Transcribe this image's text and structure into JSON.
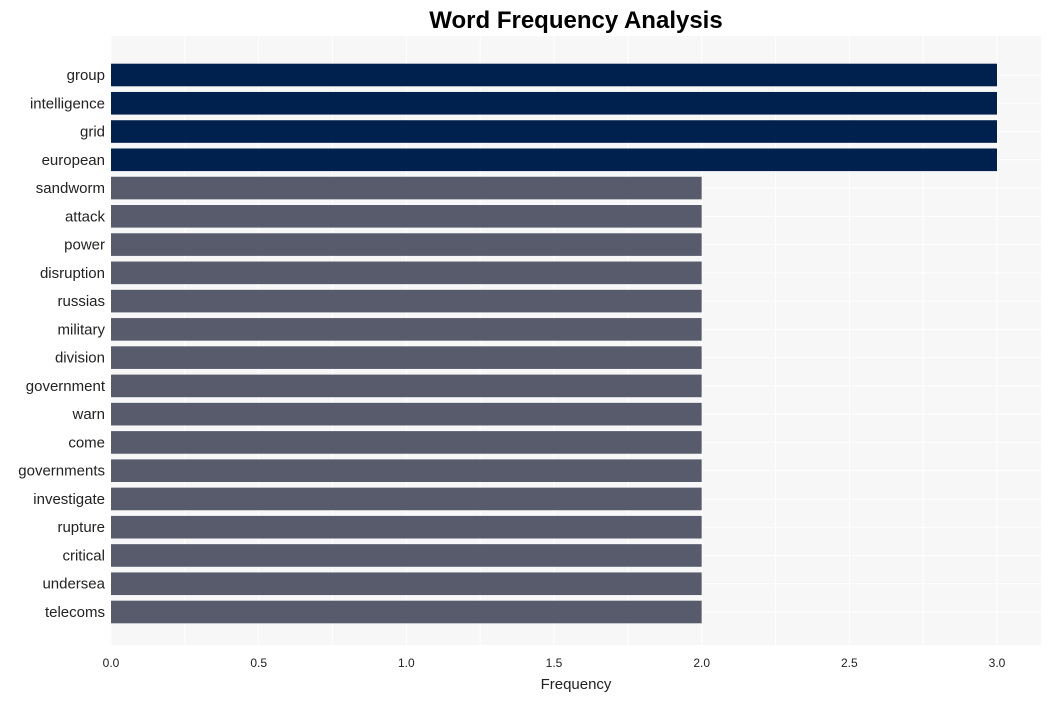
{
  "chart_data": {
    "type": "bar",
    "orientation": "horizontal",
    "title": "Word Frequency Analysis",
    "xlabel": "Frequency",
    "ylabel": "",
    "xlim": [
      0,
      3.15
    ],
    "xticks": [
      0.0,
      0.5,
      1.0,
      1.5,
      2.0,
      2.5,
      3.0
    ],
    "xtick_labels": [
      "0.0",
      "0.5",
      "1.0",
      "1.5",
      "2.0",
      "2.5",
      "3.0"
    ],
    "grid": true,
    "categories": [
      "group",
      "intelligence",
      "grid",
      "european",
      "sandworm",
      "attack",
      "power",
      "disruption",
      "russias",
      "military",
      "division",
      "government",
      "warn",
      "come",
      "governments",
      "investigate",
      "rupture",
      "critical",
      "undersea",
      "telecoms"
    ],
    "values": [
      3,
      3,
      3,
      3,
      2,
      2,
      2,
      2,
      2,
      2,
      2,
      2,
      2,
      2,
      2,
      2,
      2,
      2,
      2,
      2
    ],
    "colors": {
      "top": "#00204e",
      "other": "#575b6c",
      "plot_background": "#f7f7f7",
      "grid": "#ffffff"
    }
  }
}
